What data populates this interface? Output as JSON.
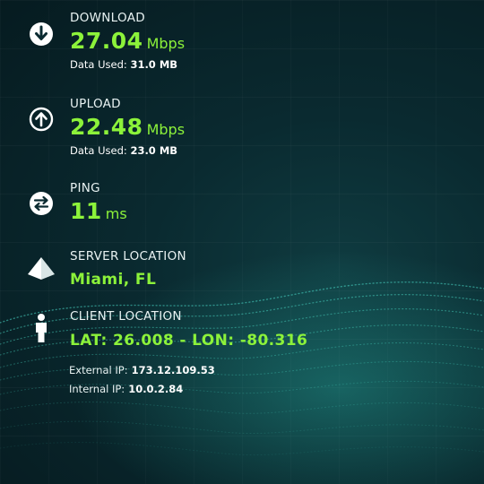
{
  "download": {
    "label": "DOWNLOAD",
    "value": "27.04",
    "unit": "Mbps",
    "data_used_label": "Data Used:",
    "data_used_value": "31.0 MB",
    "icon": "arrow-down-circle-icon"
  },
  "upload": {
    "label": "UPLOAD",
    "value": "22.48",
    "unit": "Mbps",
    "data_used_label": "Data Used:",
    "data_used_value": "23.0 MB",
    "icon": "arrow-up-circle-icon"
  },
  "ping": {
    "label": "PING",
    "value": "11",
    "unit": "ms",
    "icon": "swap-arrows-circle-icon"
  },
  "server": {
    "label": "SERVER LOCATION",
    "value": "Miami, FL",
    "icon": "pyramid-icon"
  },
  "client": {
    "label": "CLIENT LOCATION",
    "value": "LAT: 26.008 - LON: -80.316",
    "icon": "person-icon"
  },
  "network": {
    "external_label": "External IP:",
    "external_value": "173.12.109.53",
    "internal_label": "Internal IP:",
    "internal_value": "10.0.2.84"
  },
  "colors": {
    "accent": "#8cf23a",
    "background": "#0a2a30",
    "text": "#ffffff"
  }
}
